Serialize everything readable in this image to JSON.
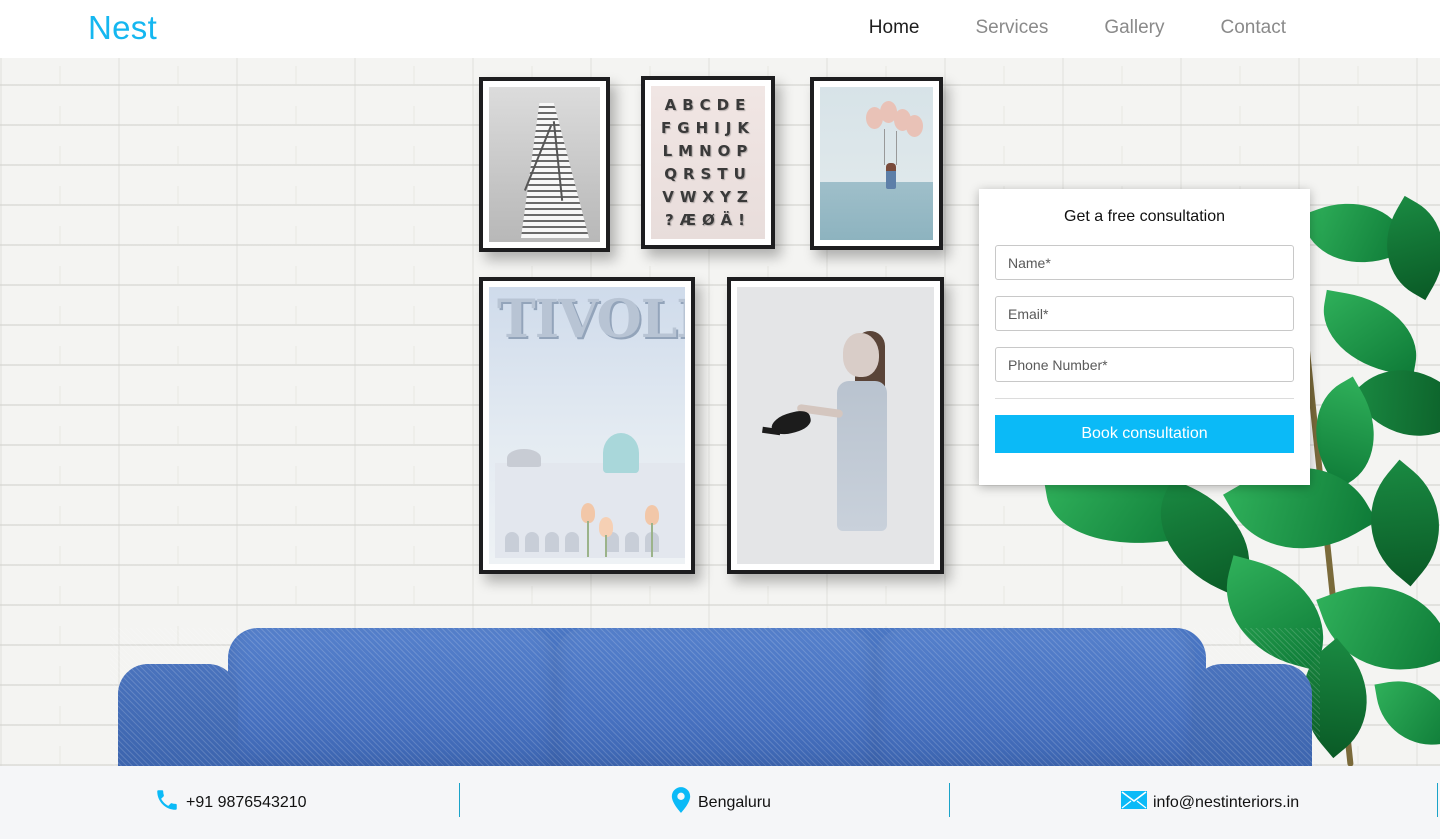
{
  "header": {
    "brand": "Nest",
    "nav": [
      {
        "label": "Home",
        "active": true
      },
      {
        "label": "Services",
        "active": false
      },
      {
        "label": "Gallery",
        "active": false
      },
      {
        "label": "Contact",
        "active": false
      }
    ]
  },
  "hero": {
    "art": {
      "alphabet_rows": [
        "ABCDE",
        "FGHIJK",
        "LMNOP",
        "QRSTU",
        "VWXYZ",
        "?ÆØÄ!"
      ],
      "tivoli_text": "TIVOLI"
    }
  },
  "form": {
    "title": "Get a free consultation",
    "name_placeholder": "Name*",
    "email_placeholder": "Email*",
    "phone_placeholder": "Phone Number*",
    "submit_label": "Book consultation"
  },
  "footer": {
    "phone": "+91 9876543210",
    "location": "Bengaluru",
    "email": "info@nestinteriors.in"
  },
  "colors": {
    "accent": "#0bbaf7",
    "brand": "#15b7f0",
    "sofa": "#4771c0",
    "footer_bg": "#f5f6f8"
  },
  "icons": [
    "phone-icon",
    "location-pin-icon",
    "mail-icon"
  ]
}
